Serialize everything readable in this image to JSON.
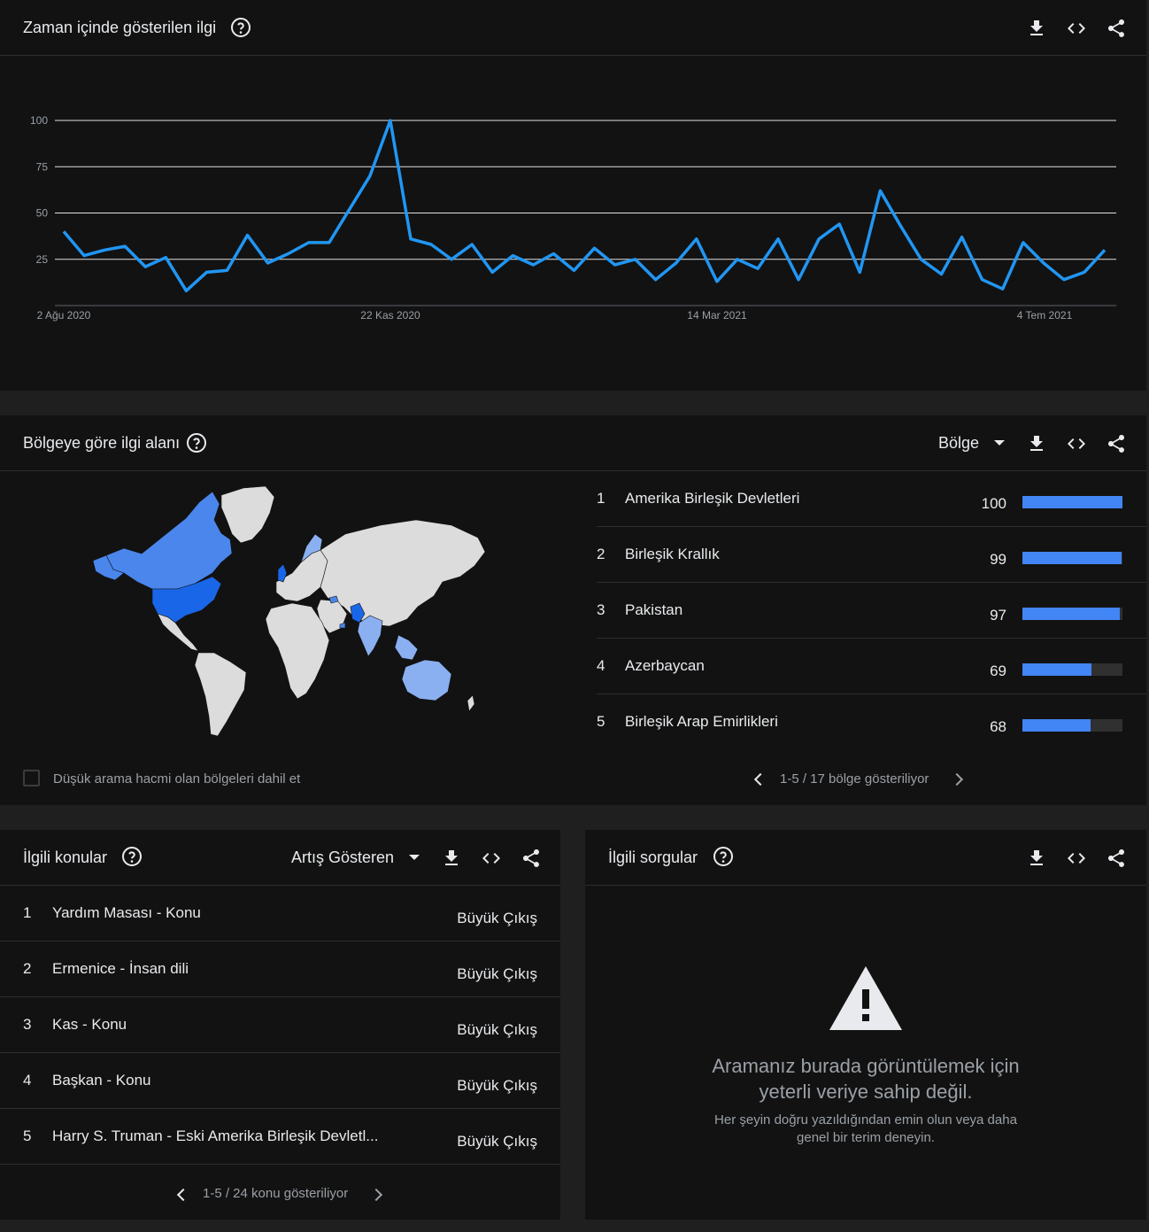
{
  "interest_over_time": {
    "title": "Zaman içinde gösterilen ilgi",
    "help_icon": "help-circle-icon",
    "chart_data": {
      "type": "line",
      "x_tick_labels": [
        "2 Ağu 2020",
        "22 Kas 2020",
        "14 Mar 2021",
        "4 Tem 2021"
      ],
      "y_tick_labels": [
        "100",
        "75",
        "50",
        "25"
      ],
      "ylim": [
        0,
        100
      ],
      "grid": true,
      "color": "#2196f3",
      "values": [
        40,
        27,
        30,
        32,
        21,
        26,
        8,
        18,
        19,
        38,
        23,
        28,
        34,
        34,
        52,
        70,
        100,
        36,
        33,
        25,
        33,
        18,
        27,
        22,
        28,
        19,
        31,
        22,
        25,
        14,
        23,
        36,
        13,
        25,
        20,
        36,
        14,
        36,
        44,
        18,
        62,
        43,
        25,
        17,
        37,
        14,
        9,
        34,
        23,
        14,
        18,
        30
      ]
    }
  },
  "interest_by_region": {
    "title": "Bölgeye göre ilgi alanı",
    "dropdown_label": "Bölge",
    "regions": [
      {
        "rank": "1",
        "name": "Amerika Birleşik Devletleri",
        "value": "100",
        "fill": 1.0
      },
      {
        "rank": "2",
        "name": "Birleşik Krallık",
        "value": "99",
        "fill": 0.99
      },
      {
        "rank": "3",
        "name": "Pakistan",
        "value": "97",
        "fill": 0.97
      },
      {
        "rank": "4",
        "name": "Azerbaycan",
        "value": "69",
        "fill": 0.69
      },
      {
        "rank": "5",
        "name": "Birleşik Arap Emirlikleri",
        "value": "68",
        "fill": 0.68
      }
    ],
    "checkbox_label": "Düşük arama hacmi olan bölgeleri dahil et",
    "pager_text": "1-5 / 17 bölge gösteriliyor",
    "colors": {
      "strong": "#1a66e8",
      "mid": "#4a86ec",
      "light": "#8ab0f2",
      "base": "#dcdcdc"
    }
  },
  "related_topics": {
    "title": "İlgili konular",
    "dropdown_label": "Artış Gösteren",
    "topics": [
      {
        "rank": "1",
        "name": "Yardım Masası - Konu",
        "value": "Büyük Çıkış"
      },
      {
        "rank": "2",
        "name": "Ermenice - İnsan dili",
        "value": "Büyük Çıkış"
      },
      {
        "rank": "3",
        "name": "Kas - Konu",
        "value": "Büyük Çıkış"
      },
      {
        "rank": "4",
        "name": "Başkan - Konu",
        "value": "Büyük Çıkış"
      },
      {
        "rank": "5",
        "name": "Harry S. Truman - Eski Amerika Birleşik Devletl...",
        "value": "Büyük Çıkış"
      }
    ],
    "pager_text": "1-5 / 24 konu gösteriliyor"
  },
  "related_queries": {
    "title": "İlgili sorgular",
    "empty_title": "Aramanız burada görüntülemek için yeterli veriye sahip değil.",
    "empty_subtitle": "Her şeyin doğru yazıldığından emin olun veya daha genel bir terim deneyin.",
    "empty_icon": "warning-icon"
  }
}
